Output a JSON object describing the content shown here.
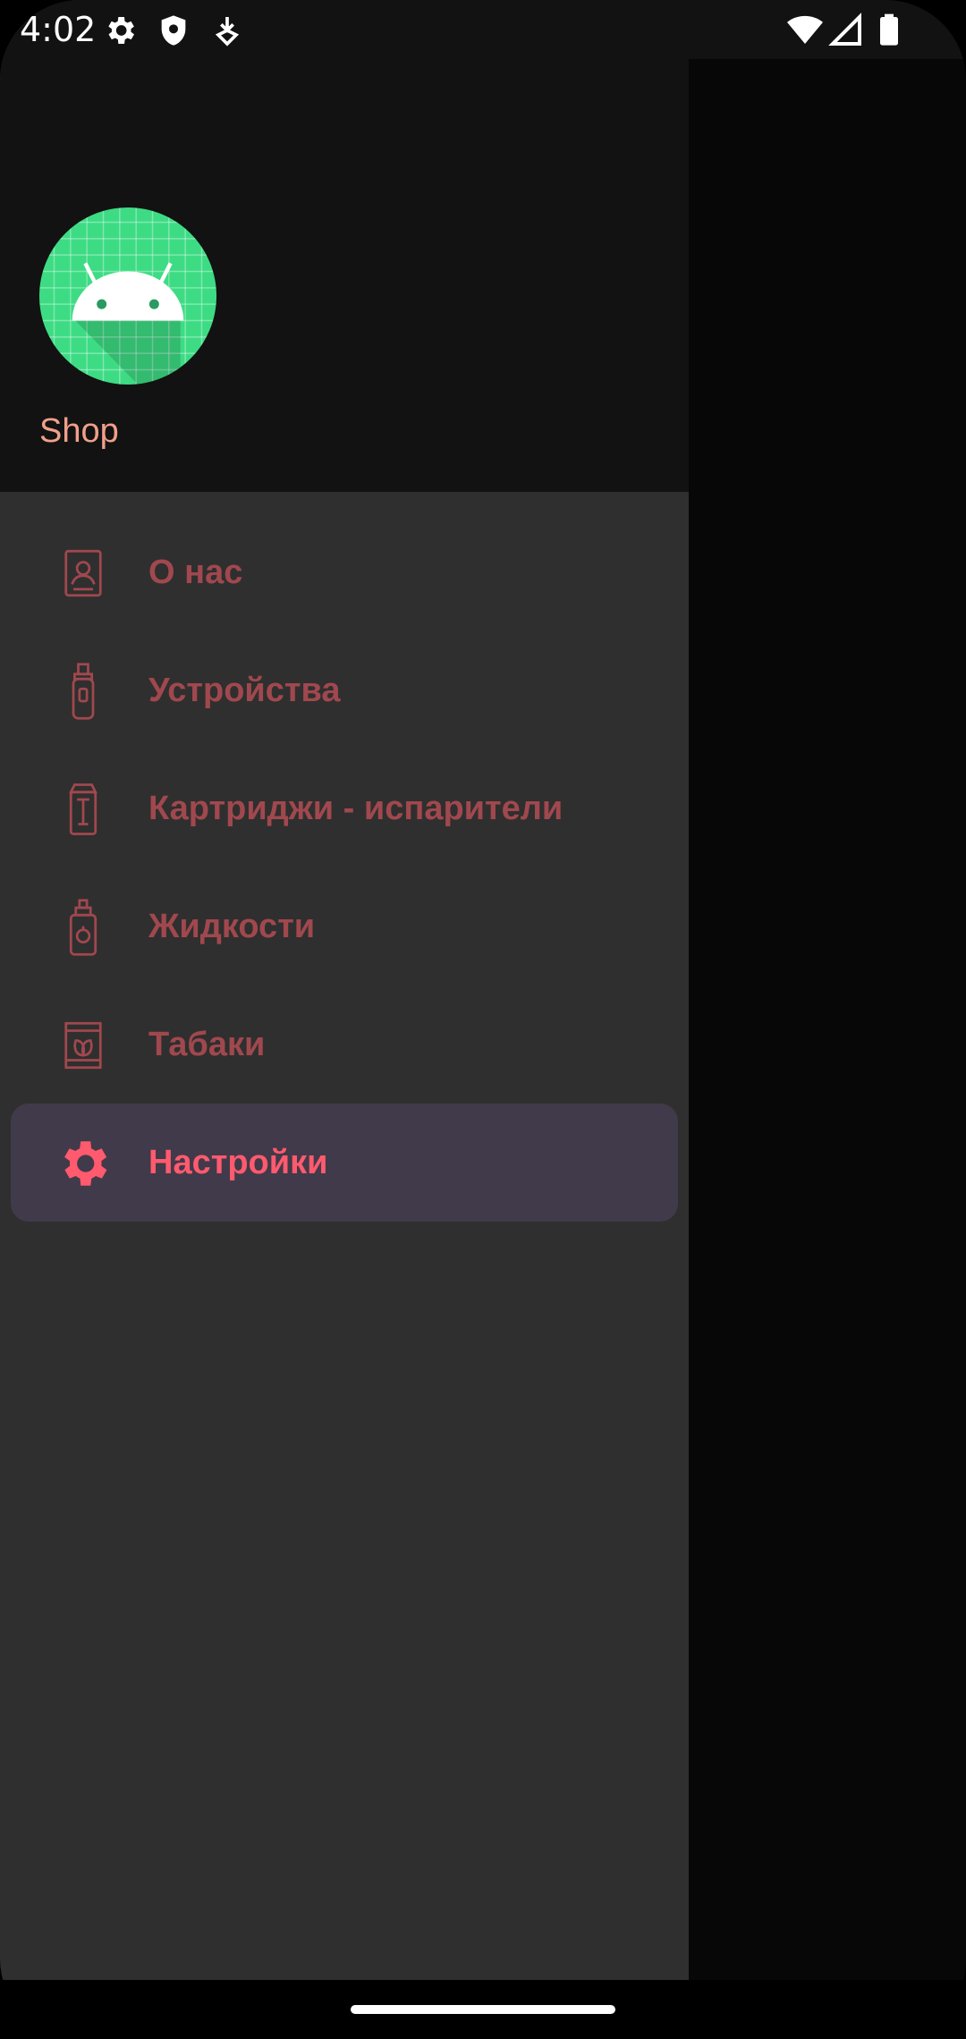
{
  "status_bar": {
    "time": "4:02",
    "left_icons": [
      "gear-icon",
      "shield-icon",
      "download-icon"
    ],
    "right_icons": [
      "wifi-icon",
      "signal-icon",
      "battery-icon"
    ]
  },
  "drawer": {
    "app_name": "Shop",
    "app_icon": "android-icon",
    "items": [
      {
        "label": "О нас",
        "icon": "contact-card-icon",
        "active": false
      },
      {
        "label": "Устройства",
        "icon": "vape-device-icon",
        "active": false
      },
      {
        "label": "Картриджи - испарители",
        "icon": "cartridge-icon",
        "active": false
      },
      {
        "label": "Жидкости",
        "icon": "liquid-bottle-icon",
        "active": false
      },
      {
        "label": "Табаки",
        "icon": "tobacco-pack-icon",
        "active": false
      },
      {
        "label": "Настройки",
        "icon": "settings-gear-icon",
        "active": true
      }
    ]
  },
  "colors": {
    "header_bg": "#121212",
    "drawer_bg": "#2f2f2f",
    "item_text": "#a0484e",
    "active_text": "#ff5a6e",
    "active_bg": "#413a4a",
    "app_name": "#f0a08a",
    "avatar_green": "#3ddc84"
  }
}
